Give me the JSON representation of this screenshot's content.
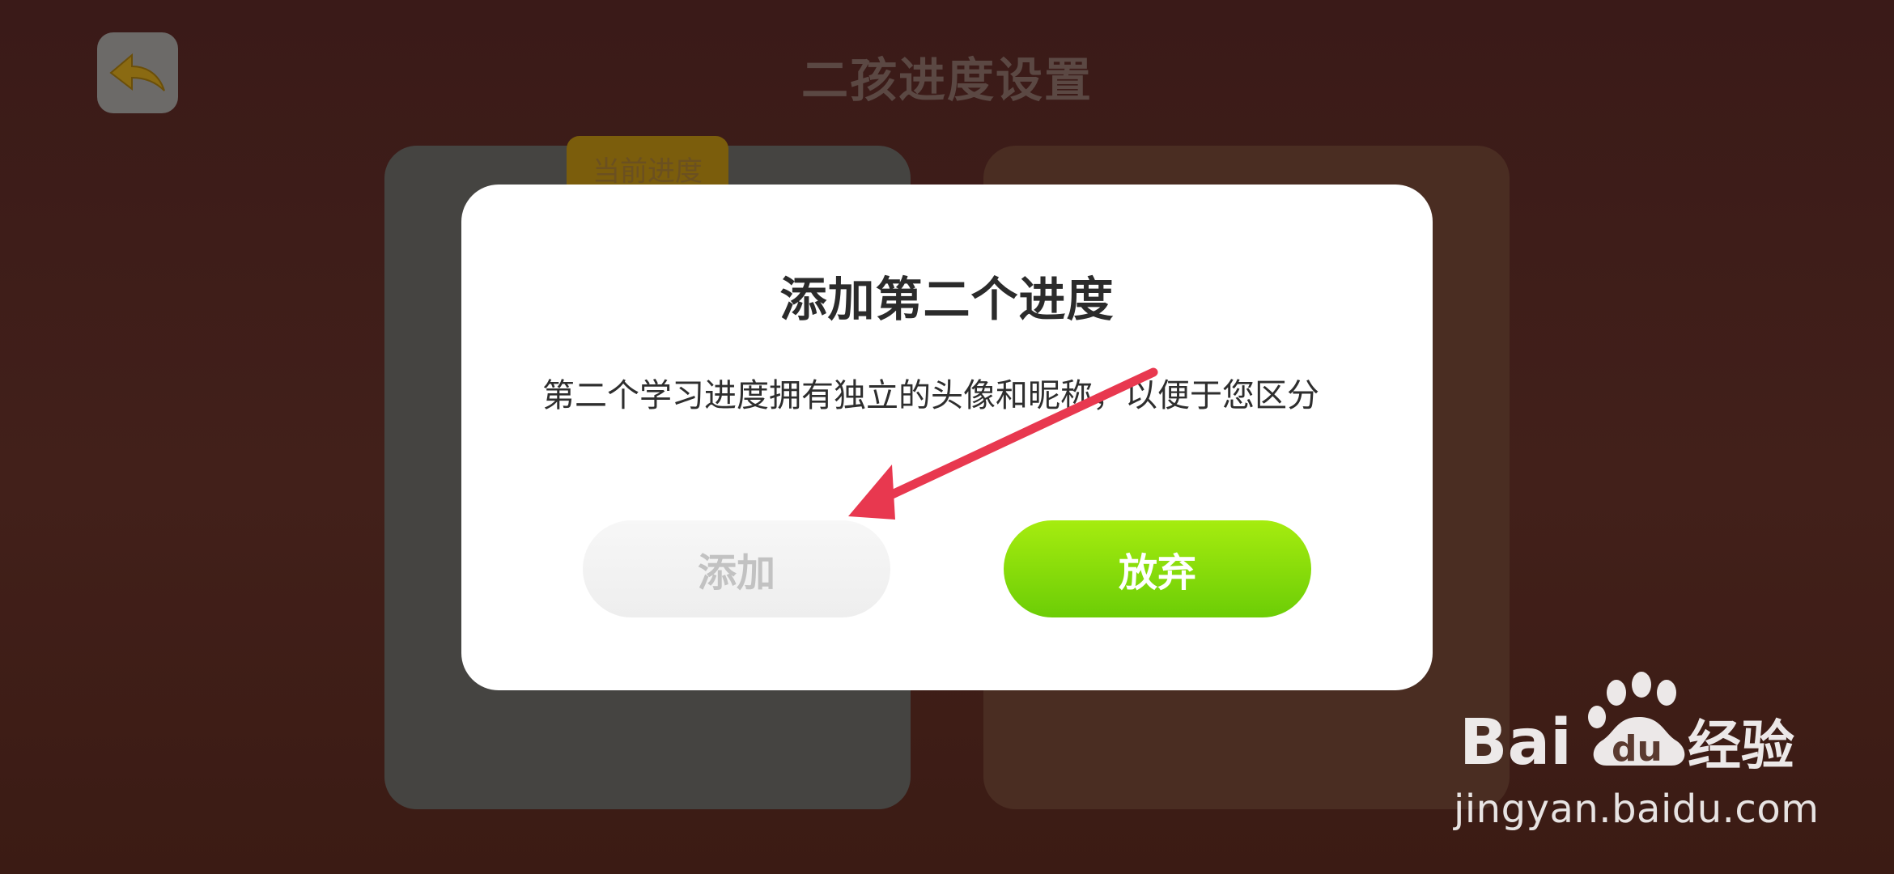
{
  "page": {
    "title": "二孩进度设置",
    "back_icon": "back-arrow-icon",
    "current_badge": "当前进度"
  },
  "dialog": {
    "title": "添加第二个进度",
    "description": "第二个学习进度拥有独立的头像和昵称，以便于您区分",
    "add_label": "添加",
    "cancel_label": "放弃"
  },
  "annotation": {
    "arrow_icon": "red-arrow-icon",
    "color": "#e8384f"
  },
  "watermark": {
    "brand": "Bai du 经验",
    "url": "jingyan.baidu.com"
  },
  "colors": {
    "primary_button": "#8edb0a",
    "disabled_button": "#f2f2f2",
    "overlay": "#3a1a18"
  }
}
